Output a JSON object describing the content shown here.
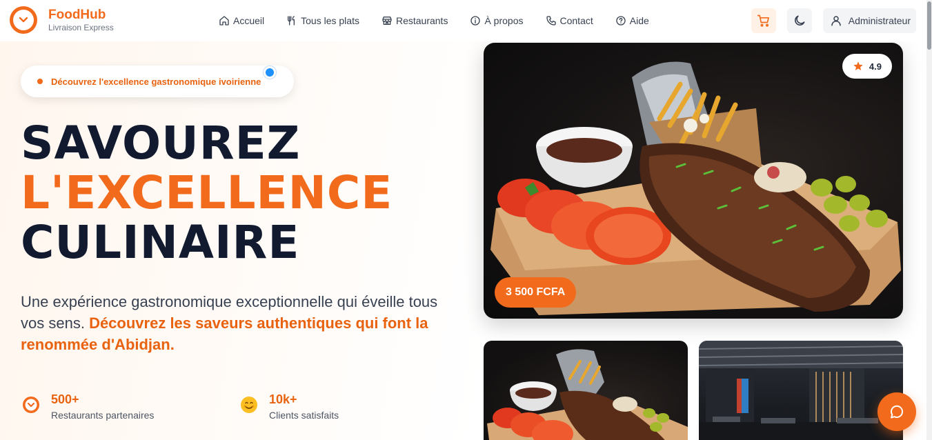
{
  "brand": {
    "name": "FoodHub",
    "tagline": "Livraison Express",
    "logo_icon": "chevron-down-icon",
    "accent_color": "#f26a1b"
  },
  "nav": {
    "links": [
      {
        "label": "Accueil",
        "icon": "home-icon"
      },
      {
        "label": "Tous les plats",
        "icon": "utensils-icon"
      },
      {
        "label": "Restaurants",
        "icon": "store-icon"
      },
      {
        "label": "À propos",
        "icon": "info-icon"
      },
      {
        "label": "Contact",
        "icon": "phone-icon"
      },
      {
        "label": "Aide",
        "icon": "help-icon"
      }
    ],
    "cart_icon": "cart-icon",
    "theme_icon": "moon-icon",
    "user_label": "Administrateur",
    "user_icon": "user-icon"
  },
  "hero": {
    "badge": "Découvrez l'excellence gastronomique ivoirienne",
    "headline": {
      "line1": "SAVOUREZ",
      "line2": "L'EXCELLENCE",
      "line3": "CULINAIRE"
    },
    "lead_plain": "Une expérience gastronomique exceptionnelle qui éveille tous vos sens.",
    "lead_highlight": "Découvrez les saveurs authentiques qui font la renommée d'Abidjan.",
    "stats": [
      {
        "value": "500+",
        "label": "Restaurants partenaires",
        "icon": "restaurant-badge-icon"
      },
      {
        "value": "10k+",
        "label": "Clients satisfaits",
        "icon": "smiley-icon"
      }
    ]
  },
  "featured": {
    "rating": "4.9",
    "rating_icon": "star-icon",
    "price": "3 500 FCFA",
    "image": "grilled-ribs-with-fries-photo"
  },
  "gallery": [
    {
      "image": "grilled-ribs-platter-photo"
    },
    {
      "image": "restaurant-interior-photo"
    }
  ],
  "chat": {
    "icon": "chat-bubble-icon"
  }
}
